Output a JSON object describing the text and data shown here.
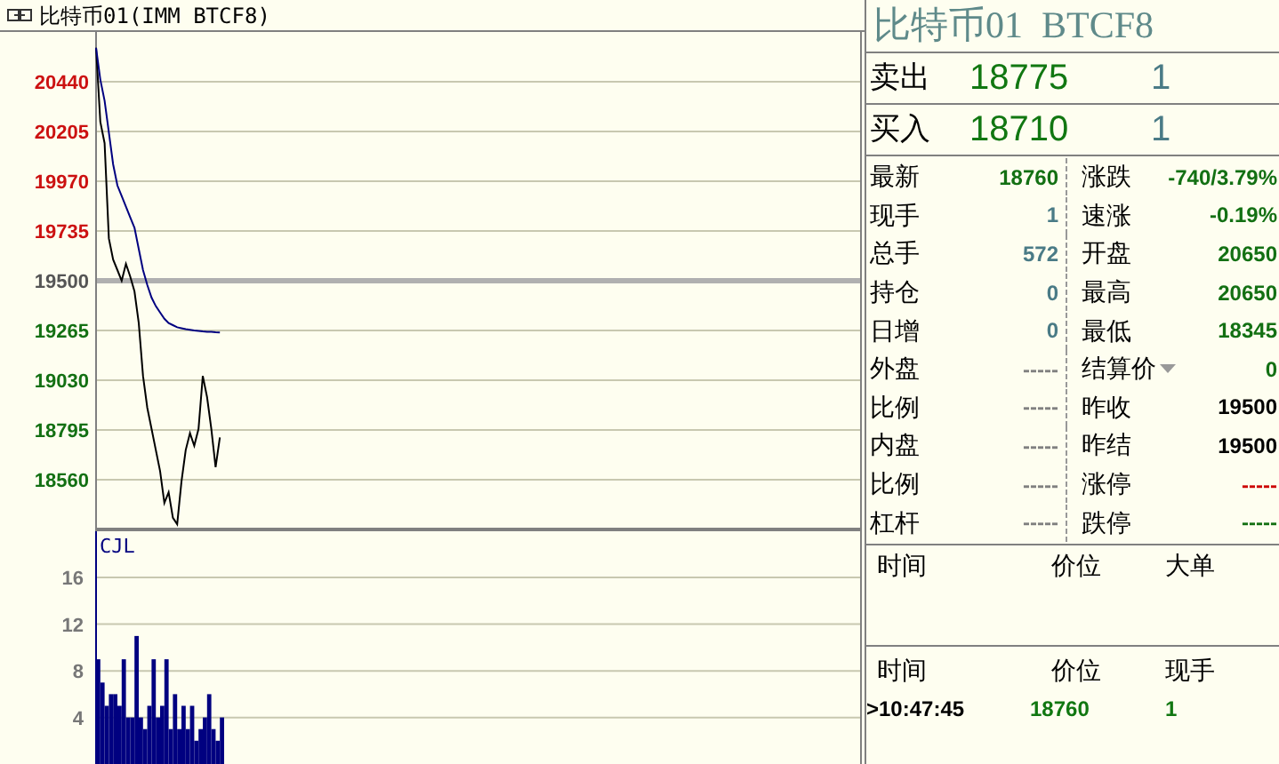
{
  "header": {
    "title": "比特币01(IMM BTCF8)"
  },
  "price_chart": {
    "y_labels": [
      {
        "text": "20440",
        "kind": "grid",
        "color": "#cc1111"
      },
      {
        "text": "20205",
        "kind": "grid",
        "color": "#cc1111"
      },
      {
        "text": "19970",
        "kind": "grid",
        "color": "#cc1111"
      },
      {
        "text": "19735",
        "kind": "grid",
        "color": "#cc1111"
      },
      {
        "text": "19500",
        "kind": "reference",
        "color": "#555555"
      },
      {
        "text": "19265",
        "kind": "grid",
        "color": "#137013"
      },
      {
        "text": "19030",
        "kind": "grid",
        "color": "#137013"
      },
      {
        "text": "18795",
        "kind": "grid",
        "color": "#137013"
      },
      {
        "text": "18560",
        "kind": "grid",
        "color": "#137013"
      }
    ]
  },
  "volume_chart": {
    "label": "CJL",
    "y_labels": [
      "16",
      "12",
      "8",
      "4"
    ]
  },
  "quote": {
    "title": "比特币01  BTCF8",
    "orders": [
      {
        "label": "卖出",
        "price": "18775",
        "volume": "1"
      },
      {
        "label": "买入",
        "price": "18710",
        "volume": "1"
      }
    ],
    "stats": [
      {
        "left": {
          "label": "最新",
          "value": "18760",
          "color": "#137013"
        },
        "right": {
          "kind": "plain",
          "label": "涨跌",
          "value": "-740/3.79%",
          "color": "#137013"
        }
      },
      {
        "left": {
          "label": "现手",
          "value": "1",
          "color": "#4a7b86"
        },
        "right": {
          "kind": "plain",
          "label": "速涨",
          "value": "-0.19%",
          "color": "#137013"
        }
      },
      {
        "left": {
          "label": "总手",
          "value": "572",
          "color": "#4a7b86"
        },
        "right": {
          "kind": "plain",
          "label": "开盘",
          "value": "20650",
          "color": "#137013"
        }
      },
      {
        "left": {
          "label": "持仓",
          "value": "0",
          "color": "#4a7b86"
        },
        "right": {
          "kind": "plain",
          "label": "最高",
          "value": "20650",
          "color": "#137013"
        }
      },
      {
        "left": {
          "label": "日增",
          "value": "0",
          "color": "#4a7b86"
        },
        "right": {
          "kind": "plain",
          "label": "最低",
          "value": "18345",
          "color": "#137013"
        }
      },
      {
        "left": {
          "label": "外盘",
          "value": "-----",
          "color": "#808080"
        },
        "right": {
          "kind": "dropdown",
          "label": "结算价",
          "value": "0",
          "color": "#137013"
        }
      },
      {
        "left": {
          "label": "比例",
          "value": "-----",
          "color": "#808080"
        },
        "right": {
          "kind": "plain",
          "label": "昨收",
          "value": "19500",
          "color": "#000000"
        }
      },
      {
        "left": {
          "label": "内盘",
          "value": "-----",
          "color": "#808080"
        },
        "right": {
          "kind": "plain",
          "label": "昨结",
          "value": "19500",
          "color": "#000000"
        }
      },
      {
        "left": {
          "label": "比例",
          "value": "-----",
          "color": "#808080"
        },
        "right": {
          "kind": "plain",
          "label": "涨停",
          "value": "-----",
          "color": "#cc0000"
        }
      },
      {
        "left": {
          "label": "杠杆",
          "value": "-----",
          "color": "#808080"
        },
        "right": {
          "kind": "plain",
          "label": "跌停",
          "value": "-----",
          "color": "#137013"
        }
      }
    ]
  },
  "big_orders": {
    "columns": [
      "时间",
      "价位",
      "大单"
    ]
  },
  "trades": {
    "columns": [
      "时间",
      "价位",
      "现手"
    ],
    "rows": [
      {
        "time": ">10:47:45",
        "price": "18760",
        "volume": "1"
      }
    ]
  }
}
